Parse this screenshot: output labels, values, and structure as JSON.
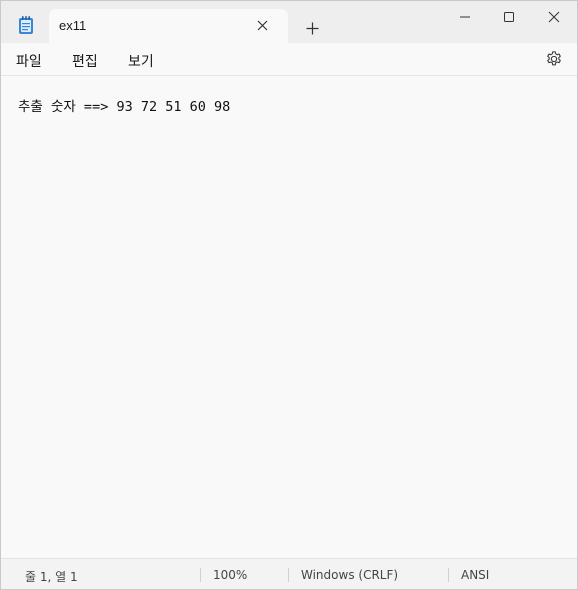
{
  "titlebar": {
    "app_icon": "notepad-icon",
    "tab_title": "ex11",
    "tab_close_icon": "close-icon",
    "new_tab_icon": "plus-icon",
    "window_controls": [
      "minimize-icon",
      "maximize-icon",
      "close-icon"
    ]
  },
  "menu": {
    "items": [
      "파일",
      "편집",
      "보기"
    ],
    "settings_icon": "gear-icon"
  },
  "editor": {
    "content": "추출 숫자 ==> 93 72 51 60 98"
  },
  "status": {
    "position": "줄 1, 열 1",
    "zoom": "100%",
    "line_endings": "Windows (CRLF)",
    "encoding": "ANSI"
  },
  "colors": {
    "titlebar_bg": "#eeeeee",
    "editor_bg": "#f9f9f9",
    "statusbar_bg": "#f3f3f3",
    "accent": "#2b78c8"
  }
}
